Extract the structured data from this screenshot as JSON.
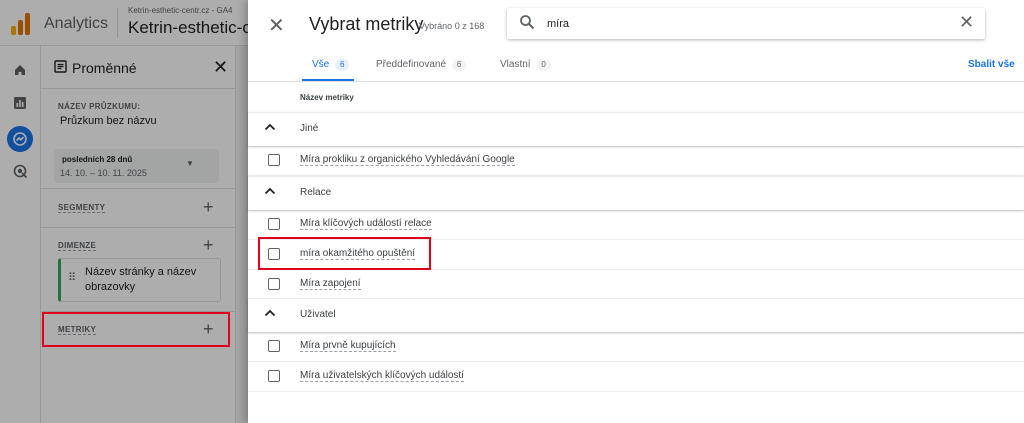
{
  "colors": {
    "accent": "#1a73e8",
    "highlight": "#e0001a",
    "dimension_chip": "#34a853"
  },
  "app": {
    "name": "Analytics",
    "account": "Ketrin-esthetic-centr.cz - GA4",
    "property": "Ketrin-esthetic-c"
  },
  "rail": {
    "icons": [
      "home-icon",
      "reports-icon",
      "explore-icon",
      "advertising-icon"
    ]
  },
  "variables": {
    "title": "Proměnné",
    "exploration_label": "NÁZEV PRŮZKUMU:",
    "exploration_name": "Průzkum bez názvu",
    "date_preset": "posledních 28 dnů",
    "date_range": "14. 10. – 10. 11. 2025",
    "segments_label": "SEGMENTY",
    "dimensions_label": "DIMENZE",
    "dimension_item": "Název stránky a název obrazovky",
    "metrics_label": "METRIKY",
    "add_symbol": "+"
  },
  "dialog": {
    "title": "Vybrat metriky",
    "selected_count": "Vybráno 0 z 168",
    "search": {
      "value": "míra",
      "placeholder": ""
    },
    "tabs": [
      {
        "label": "Vše",
        "count": "6"
      },
      {
        "label": "Předdefinované",
        "count": "6"
      },
      {
        "label": "Vlastní",
        "count": "0"
      }
    ],
    "expand_all": "Sbalit vše",
    "column_header": "Název metriky",
    "groups": [
      {
        "label": "Jiné",
        "items": [
          "Míra prokliku z organického Vyhledávání Google"
        ]
      },
      {
        "label": "Relace",
        "items": [
          "Míra klíčových událostí relace",
          "míra okamžitého opuštění",
          "Míra zapojení"
        ]
      },
      {
        "label": "Uživatel",
        "items": [
          "Míra prvně kupujících",
          "Míra uživatelských klíčových událostí"
        ]
      }
    ]
  }
}
